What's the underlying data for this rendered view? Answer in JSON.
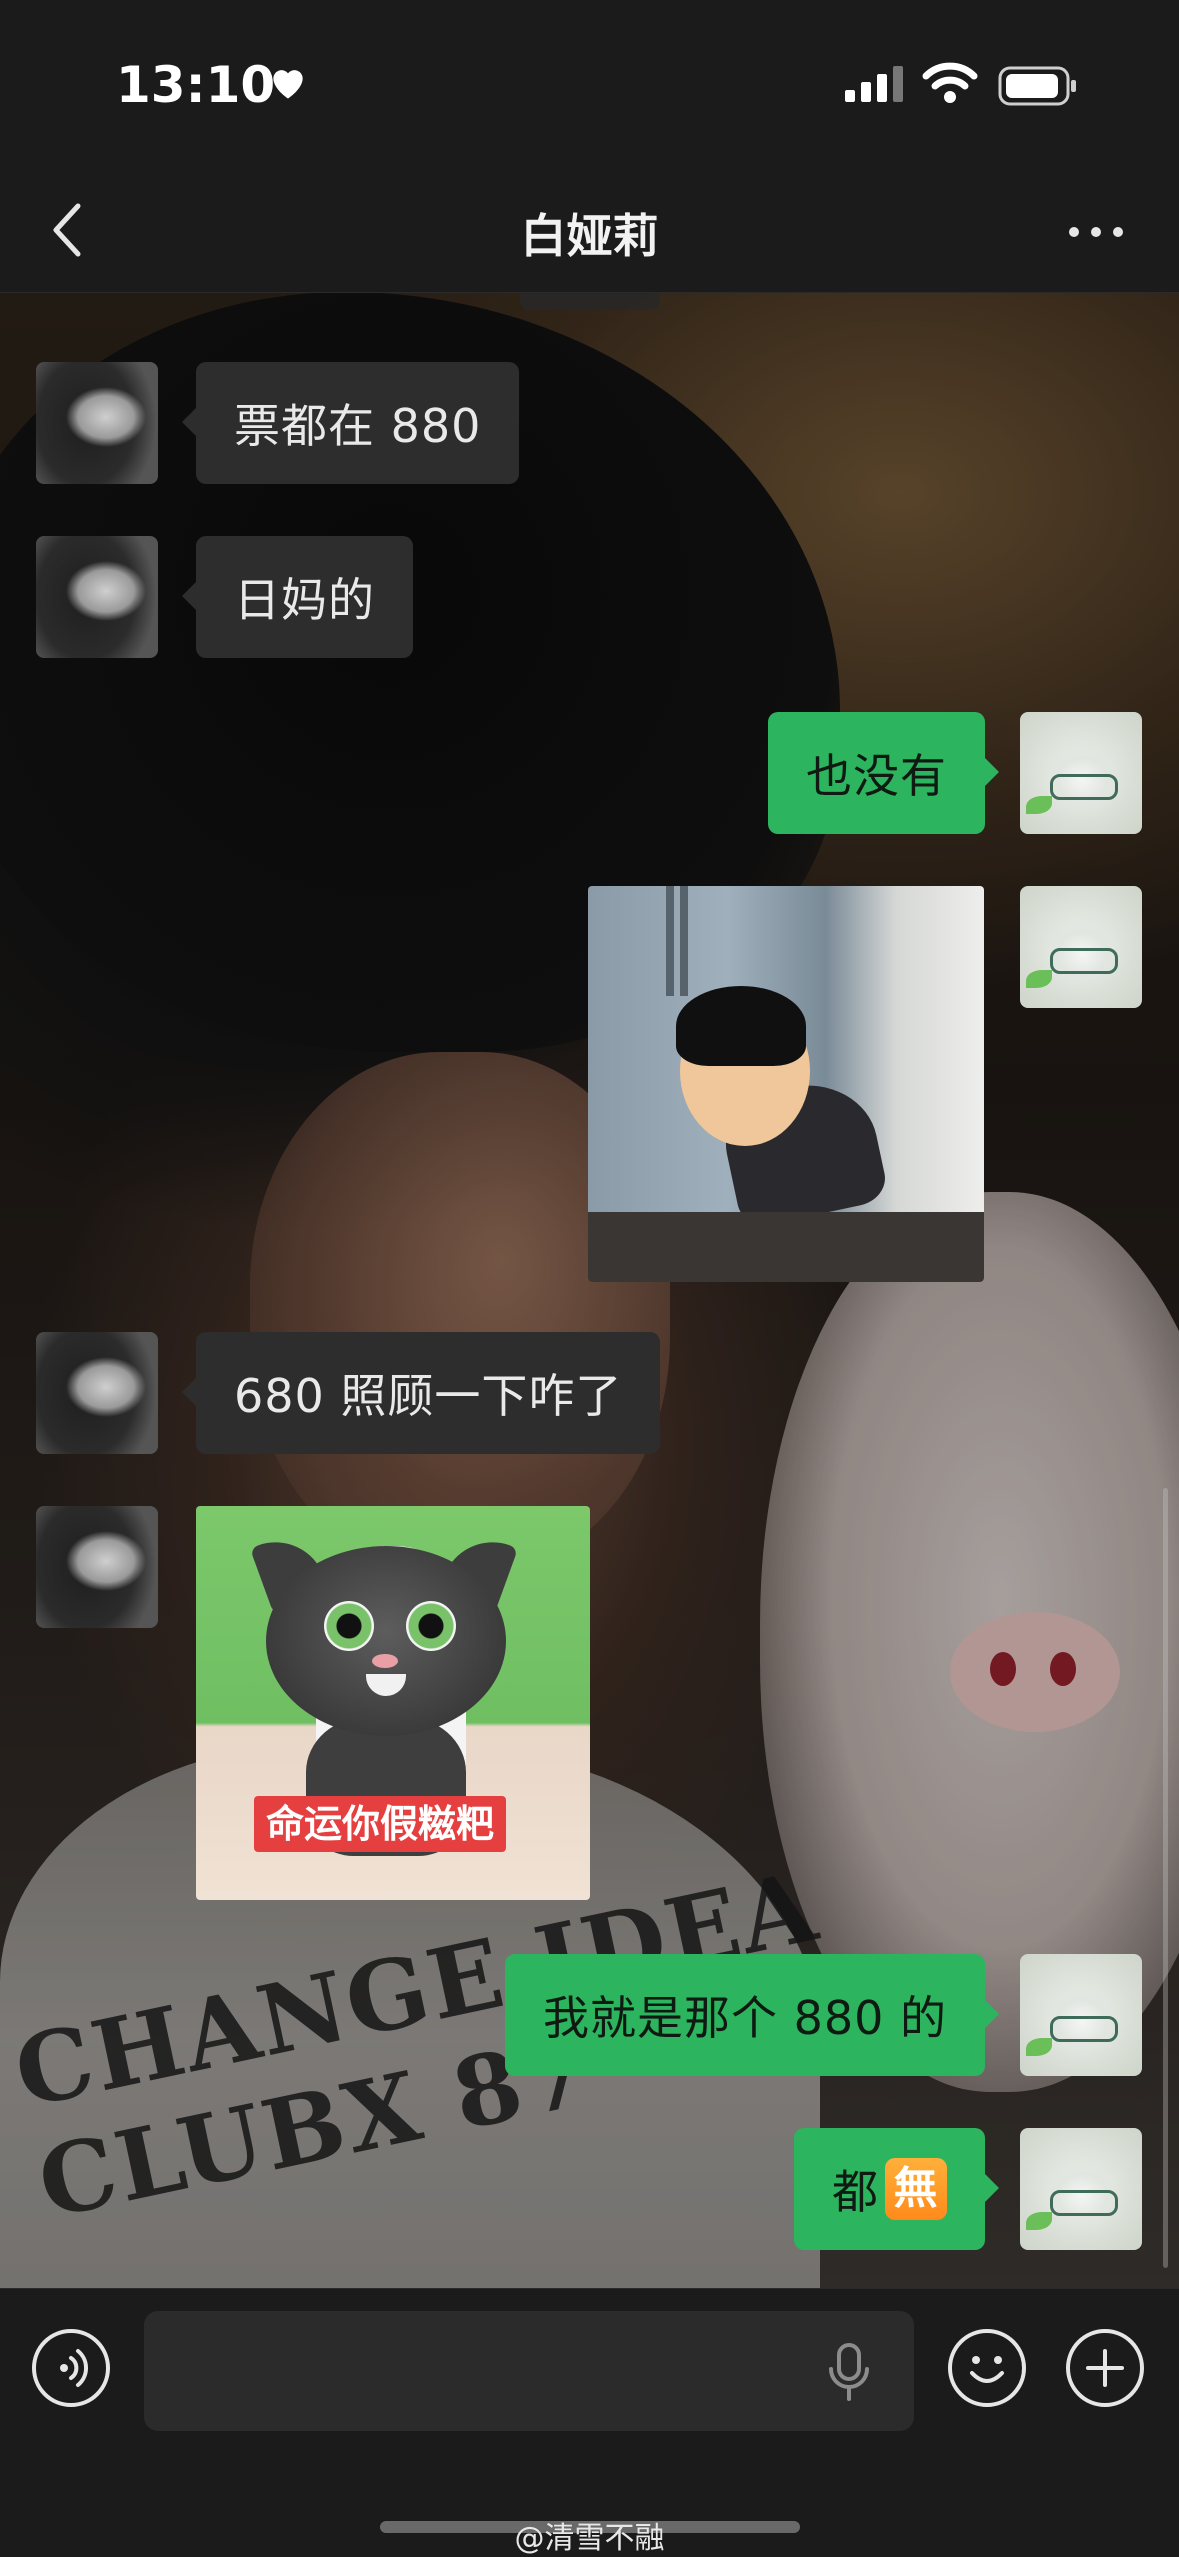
{
  "status_bar": {
    "time": "13:10"
  },
  "header": {
    "title": "白娅莉"
  },
  "messages": [
    {
      "side": "in",
      "type": "text",
      "text": "票都在 880"
    },
    {
      "side": "in",
      "type": "text",
      "text": "日妈的"
    },
    {
      "side": "out",
      "type": "text",
      "text": "也没有"
    },
    {
      "side": "out",
      "type": "image",
      "icon": "kneeling-figure-sticker"
    },
    {
      "side": "in",
      "type": "text",
      "text": "680 照顾一下咋了"
    },
    {
      "side": "in",
      "type": "image",
      "caption": "命运你假糍粑",
      "icon": "talking-cat-sticker"
    },
    {
      "side": "out",
      "type": "text",
      "text": "我就是那个 880 的"
    },
    {
      "side": "out",
      "type": "text",
      "text": "都",
      "emoji": "無"
    }
  ],
  "input": {
    "placeholder": ""
  },
  "watermark": "@清雪不融",
  "colors": {
    "outgoing_bubble": "#2db45e",
    "incoming_bubble": "#2d2d2d",
    "bar_bg": "#1b1b1b"
  }
}
